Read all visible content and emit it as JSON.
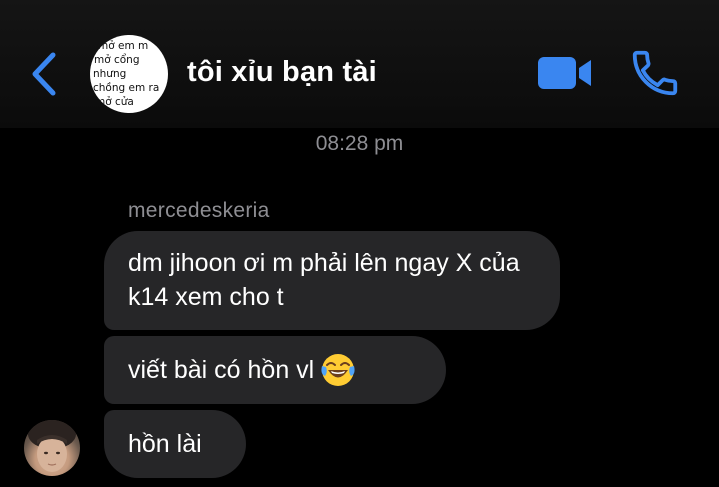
{
  "header": {
    "title": "tôi xỉu bạn tài",
    "group_avatar_lines": [
      "mở em m",
      "mở cổng",
      "nhưng",
      "chồng em ra",
      "mở cửa"
    ],
    "accent_color": "#3A86F0"
  },
  "conversation": {
    "timestamp": "08:28 pm",
    "sender_name": "mercedeskeria",
    "messages": [
      {
        "text": "dm jihoon ơi m phải lên ngay X của k14 xem cho t"
      },
      {
        "text": "viết bài có hồn vl",
        "emoji": "face-with-tears-of-joy"
      },
      {
        "text": "hồn lài"
      }
    ]
  },
  "colors": {
    "background": "#000000",
    "bubble": "#262628",
    "meta_text": "#8E8E93"
  }
}
